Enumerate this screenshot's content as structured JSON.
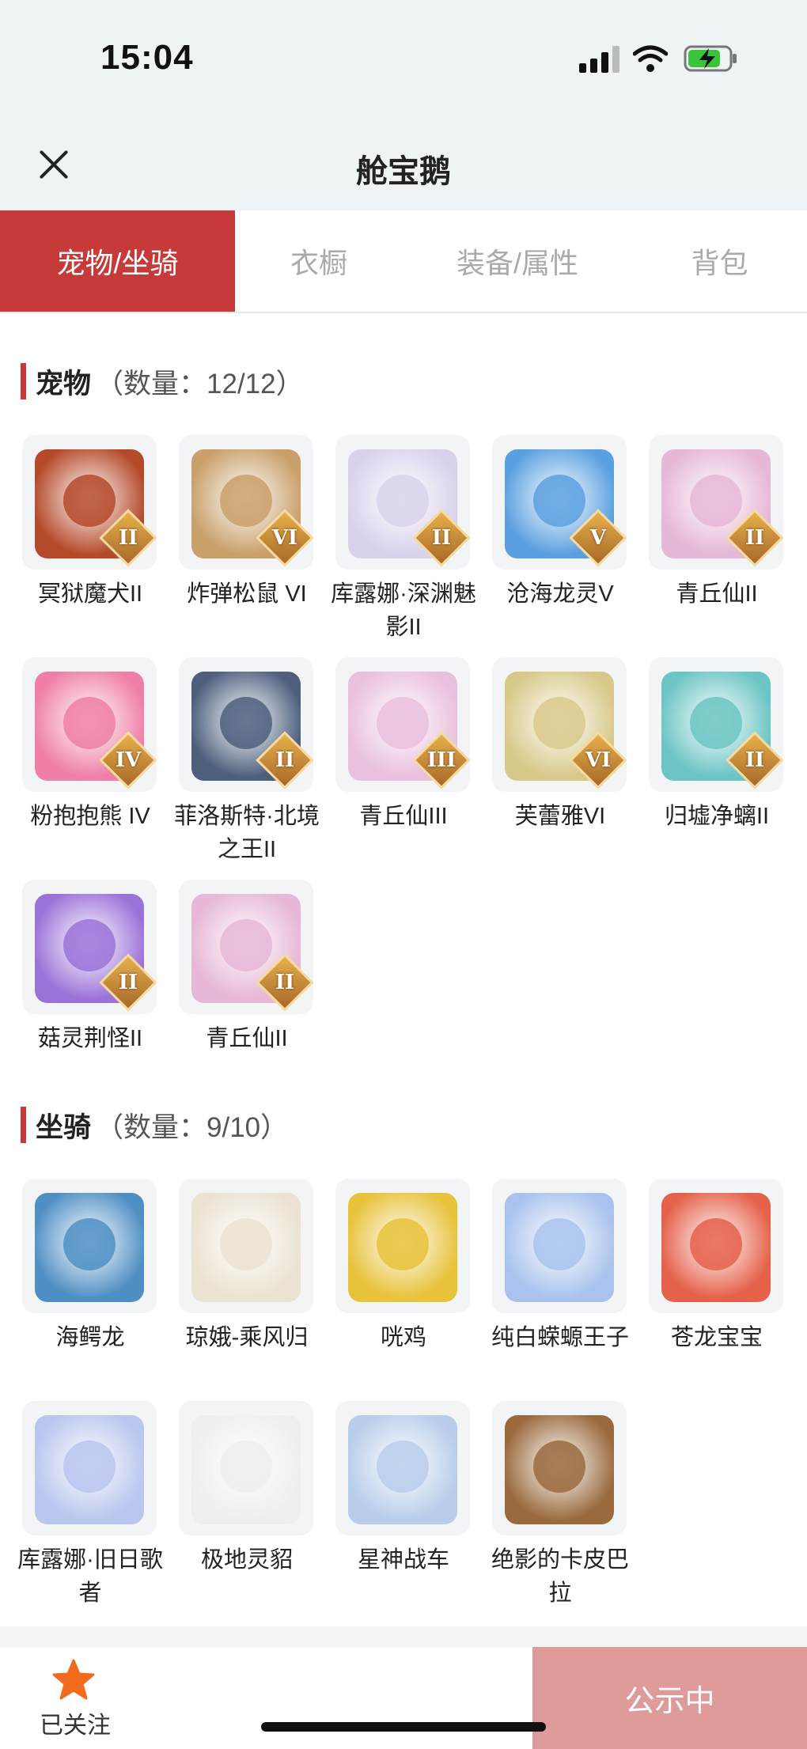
{
  "status_bar": {
    "time": "15:04"
  },
  "header": {
    "title": "舱宝鹅"
  },
  "tabs": [
    "宠物/坐骑",
    "衣橱",
    "装备/属性",
    "背包"
  ],
  "pets": {
    "title": "宠物",
    "count": "（数量：12/12）",
    "items": [
      {
        "name": "冥狱魔犬II",
        "badge": "II",
        "color": "#b54a2a"
      },
      {
        "name": "炸弹松鼠 VI",
        "badge": "VI",
        "color": "#c9a06a"
      },
      {
        "name": "库露娜·深渊魅影II",
        "badge": "II",
        "color": "#d9d2ec"
      },
      {
        "name": "沧海龙灵V",
        "badge": "V",
        "color": "#5aa0e0"
      },
      {
        "name": "青丘仙II",
        "badge": "II",
        "color": "#e6b7d6"
      },
      {
        "name": "粉抱抱熊 IV",
        "badge": "IV",
        "color": "#ef7fa6"
      },
      {
        "name": "菲洛斯特·北境之王II",
        "badge": "II",
        "color": "#4d5f7c"
      },
      {
        "name": "青丘仙III",
        "badge": "III",
        "color": "#e9c0dd"
      },
      {
        "name": "芙蕾雅VI",
        "badge": "VI",
        "color": "#d8c98a"
      },
      {
        "name": "归墟净螭II",
        "badge": "II",
        "color": "#6cc4c4"
      },
      {
        "name": "菇灵荆怪II",
        "badge": "II",
        "color": "#9b72d8"
      },
      {
        "name": "青丘仙II",
        "badge": "II",
        "color": "#e6b7d6"
      }
    ]
  },
  "mounts": {
    "title": "坐骑",
    "count": "（数量：9/10）",
    "items": [
      {
        "name": "海鳄龙",
        "color": "#4f8fc4"
      },
      {
        "name": "琼娥-乘风归",
        "color": "#ebe3d2"
      },
      {
        "name": "咣鸡",
        "color": "#e8c23a"
      },
      {
        "name": "纯白蝾螈王子",
        "color": "#a9c3ee"
      },
      {
        "name": "苍龙宝宝",
        "color": "#e5614a"
      },
      {
        "name": "库露娜·旧日歌者",
        "color": "#b9c6ee"
      },
      {
        "name": "极地灵貂",
        "color": "#eeeeee"
      },
      {
        "name": "星神战车",
        "color": "#b8cdea"
      },
      {
        "name": "绝影的卡皮巴拉",
        "color": "#9a6a3e"
      }
    ]
  },
  "bottom_bar": {
    "follow_label": "已关注",
    "publish_label": "公示中"
  },
  "colors": {
    "accent": "#c73a3a",
    "publish_bg": "#df9a9a",
    "star": "#f26a1b"
  }
}
